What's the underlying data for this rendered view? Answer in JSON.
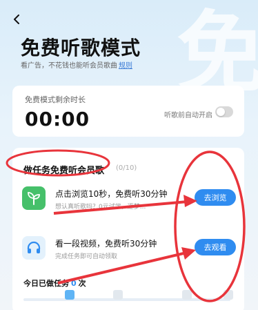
{
  "header": {
    "back_icon": "chevron-left-icon",
    "title": "免费听歌模式",
    "subtitle": "看广告，不花钱也能听会员歌曲",
    "rule_link": "规则",
    "bg_char": "免"
  },
  "timer": {
    "label": "免费模式剩余时长",
    "value": "00:00",
    "auto_label": "听歌前自动开启",
    "auto_on": false
  },
  "tasks": {
    "header": "做任务免费听会员歌",
    "progress": "(0/10)",
    "items": [
      {
        "icon": "sprout-icon",
        "title": "点击浏览10秒，免费听30分钟",
        "desc": "想认真听歌吗？0元试学，逐梦...",
        "button": "去浏览"
      },
      {
        "icon": "headphones-icon",
        "title": "看一段视频，免费听30分钟",
        "desc": "完成任务即可自动领取",
        "button": "去观看"
      }
    ],
    "today_prefix": "今日已做任务",
    "today_count": "0",
    "today_suffix": "次"
  },
  "colors": {
    "accent": "#2f8cf0",
    "annotation": "#e8343b",
    "green_icon": "#46c06a"
  }
}
